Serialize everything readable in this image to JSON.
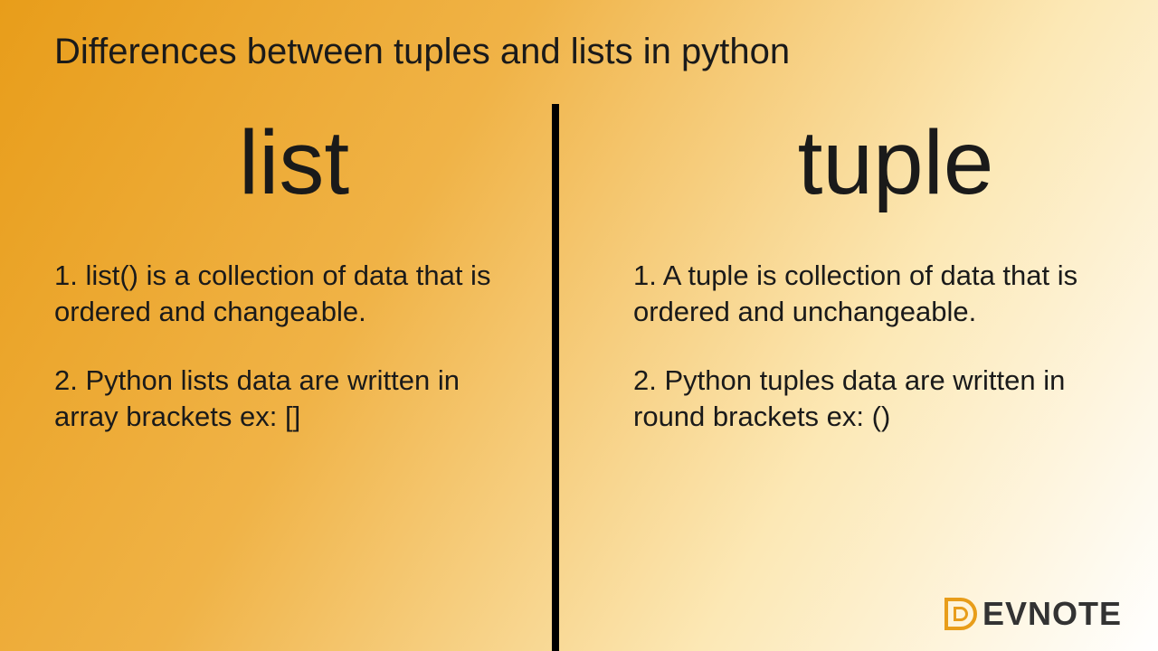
{
  "title": "Differences between tuples and lists in python",
  "left": {
    "heading": "list",
    "point1": "1. list() is a collection of data  that is ordered and changeable.",
    "point2": "2. Python lists data are written in array brackets ex: []"
  },
  "right": {
    "heading": "tuple",
    "point1": "1. A tuple is collection of data that is ordered and unchangeable.",
    "point2": "2. Python tuples data are written in round brackets  ex: ()"
  },
  "logo": {
    "brand_rest": "EVNOTE"
  }
}
